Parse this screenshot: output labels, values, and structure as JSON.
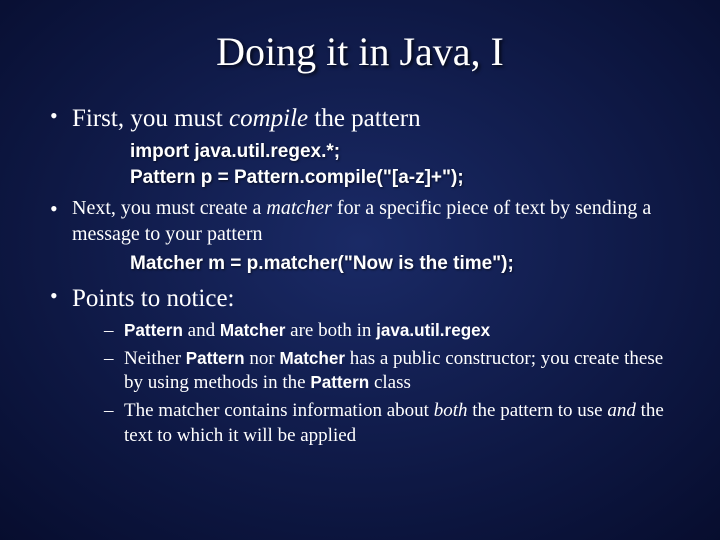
{
  "title": "Doing it in Java, I",
  "bullets": {
    "b1_pre": "First, you must ",
    "b1_em": "compile",
    "b1_post": " the pattern",
    "code1_l1": "import java.util.regex.*;",
    "code1_l2": "Pattern p = Pattern.compile(\"[a-z]+\");",
    "b2_pre": "Next, you must create a ",
    "b2_em": "matcher",
    "b2_post": " for a specific piece of text by sending a message to your pattern",
    "code2": "Matcher m = p.matcher(\"Now is the time\");",
    "b3": "Points to notice:"
  },
  "sub": {
    "s1_a": "Pattern",
    "s1_b": " and ",
    "s1_c": "Matcher",
    "s1_d": " are both in ",
    "s1_e": "java.util.regex",
    "s2_a": "Neither ",
    "s2_b": "Pattern",
    "s2_c": " nor ",
    "s2_d": "Matcher",
    "s2_e": " has a public constructor; you create these by using methods in the ",
    "s2_f": "Pattern",
    "s2_g": " class",
    "s3_a": "The matcher contains information about ",
    "s3_b": "both",
    "s3_c": " the pattern to use ",
    "s3_d": "and",
    "s3_e": " the text to which it will be applied"
  }
}
